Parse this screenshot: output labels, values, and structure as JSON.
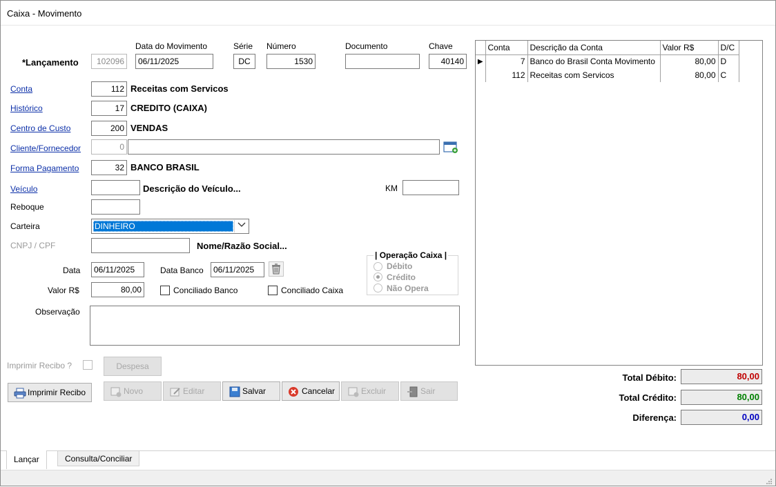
{
  "window": {
    "title": "Caixa - Movimento"
  },
  "lancamento": {
    "label": "*Lançamento",
    "value": "102096",
    "data_mov_label": "Data do Movimento",
    "data_mov": "06/11/2025",
    "serie_label": "Série",
    "serie": "DC",
    "numero_label": "Número",
    "numero": "1530",
    "documento_label": "Documento",
    "documento": "",
    "chave_label": "Chave",
    "chave": "40140"
  },
  "conta": {
    "label": "Conta",
    "code": "112",
    "desc": "Receitas com Servicos"
  },
  "historico": {
    "label": "Histórico",
    "code": "17",
    "desc": "CREDITO (CAIXA)"
  },
  "centro": {
    "label": "Centro de Custo",
    "code": "200",
    "desc": "VENDAS"
  },
  "cliente": {
    "label": "Cliente/Fornecedor",
    "code": "0",
    "desc": ""
  },
  "forma": {
    "label": "Forma Pagamento",
    "code": "32",
    "desc": "BANCO BRASIL"
  },
  "veiculo": {
    "label": "Veículo",
    "code": "",
    "desc": "Descrição do Veículo...",
    "km_label": "KM",
    "km": ""
  },
  "reboque": {
    "label": "Reboque",
    "value": ""
  },
  "carteira": {
    "label": "Carteira",
    "value": "DINHEIRO"
  },
  "cnpj": {
    "label": "CNPJ / CPF",
    "value": "",
    "nome": "Nome/Razão Social..."
  },
  "data": {
    "label": "Data",
    "value": "06/11/2025",
    "banco_label": "Data Banco",
    "banco_value": "06/11/2025"
  },
  "valor": {
    "label": "Valor R$",
    "value": "80,00",
    "conc_banco": "Conciliado Banco",
    "conc_caixa": "Conciliado Caixa"
  },
  "operacao": {
    "title": "Operação Caixa",
    "options": [
      "Débito",
      "Crédito",
      "Não Opera"
    ],
    "selected": "Crédito"
  },
  "observacao": {
    "label": "Observação",
    "value": ""
  },
  "recibo": {
    "label": "Imprimir Recibo ?",
    "despesa": "Despesa"
  },
  "buttons": {
    "imprimir": "Imprimir Recibo",
    "novo": "Novo",
    "editar": "Editar",
    "salvar": "Salvar",
    "cancelar": "Cancelar",
    "excluir": "Excluir",
    "sair": "Sair"
  },
  "grid": {
    "headers": [
      "Conta",
      "Descrição da Conta",
      "Valor R$",
      "D/C"
    ],
    "rows": [
      {
        "conta": "7",
        "desc": "Banco do Brasil Conta Movimento",
        "valor": "80,00",
        "dc": "D"
      },
      {
        "conta": "112",
        "desc": "Receitas com Servicos",
        "valor": "80,00",
        "dc": "C"
      }
    ]
  },
  "totals": {
    "debito_label": "Total Débito:",
    "debito": "80,00",
    "debito_color": "#c00000",
    "credito_label": "Total Crédito:",
    "credito": "80,00",
    "credito_color": "#008000",
    "diferenca_label": "Diferença:",
    "diferenca": "0,00",
    "diferenca_color": "#0000c0"
  },
  "tabs": [
    "Lançar",
    "Consulta/Conciliar"
  ],
  "colors": {
    "link": "#0b2fa8",
    "selection": "#0078d7"
  }
}
